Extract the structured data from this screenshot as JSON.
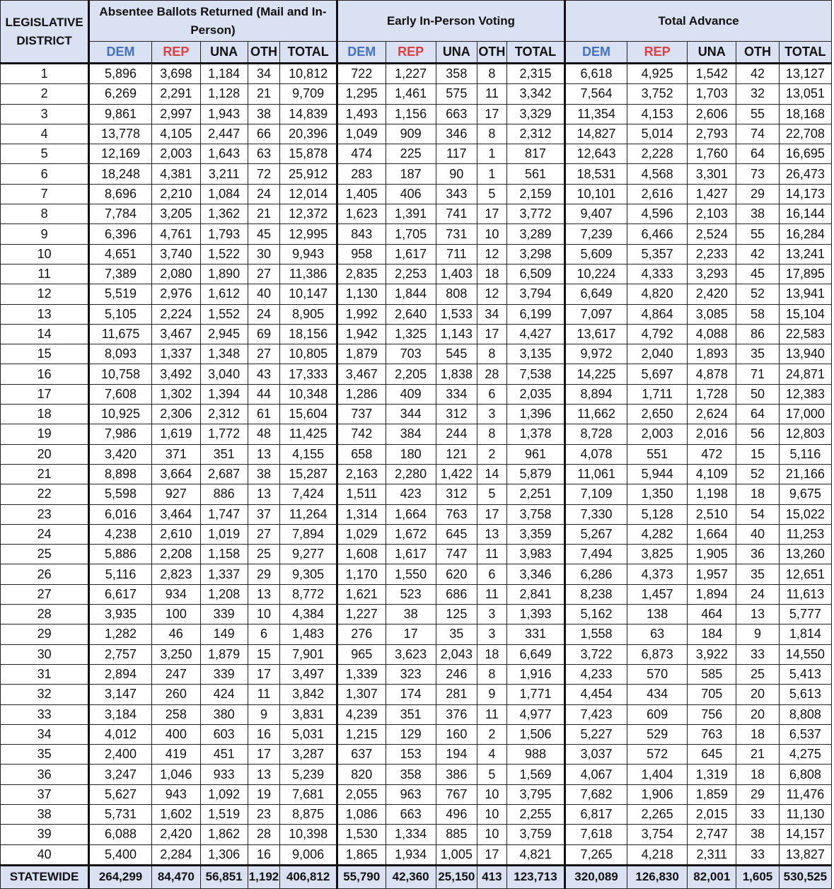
{
  "header": {
    "district_label": "LEGISLATIVE DISTRICT",
    "groups": [
      "Absentee Ballots Returned (Mail and In-Person)",
      "Early In-Person Voting",
      "Total Advance"
    ],
    "subcolumns": [
      "DEM",
      "REP",
      "UNA",
      "OTH",
      "TOTAL"
    ]
  },
  "colors": {
    "dem": "#4472c4",
    "rep": "#e04040",
    "header_bg": "#d9e1f2"
  },
  "rows": [
    [
      "1",
      "5,896",
      "3,698",
      "1,184",
      "34",
      "10,812",
      "722",
      "1,227",
      "358",
      "8",
      "2,315",
      "6,618",
      "4,925",
      "1,542",
      "42",
      "13,127"
    ],
    [
      "2",
      "6,269",
      "2,291",
      "1,128",
      "21",
      "9,709",
      "1,295",
      "1,461",
      "575",
      "11",
      "3,342",
      "7,564",
      "3,752",
      "1,703",
      "32",
      "13,051"
    ],
    [
      "3",
      "9,861",
      "2,997",
      "1,943",
      "38",
      "14,839",
      "1,493",
      "1,156",
      "663",
      "17",
      "3,329",
      "11,354",
      "4,153",
      "2,606",
      "55",
      "18,168"
    ],
    [
      "4",
      "13,778",
      "4,105",
      "2,447",
      "66",
      "20,396",
      "1,049",
      "909",
      "346",
      "8",
      "2,312",
      "14,827",
      "5,014",
      "2,793",
      "74",
      "22,708"
    ],
    [
      "5",
      "12,169",
      "2,003",
      "1,643",
      "63",
      "15,878",
      "474",
      "225",
      "117",
      "1",
      "817",
      "12,643",
      "2,228",
      "1,760",
      "64",
      "16,695"
    ],
    [
      "6",
      "18,248",
      "4,381",
      "3,211",
      "72",
      "25,912",
      "283",
      "187",
      "90",
      "1",
      "561",
      "18,531",
      "4,568",
      "3,301",
      "73",
      "26,473"
    ],
    [
      "7",
      "8,696",
      "2,210",
      "1,084",
      "24",
      "12,014",
      "1,405",
      "406",
      "343",
      "5",
      "2,159",
      "10,101",
      "2,616",
      "1,427",
      "29",
      "14,173"
    ],
    [
      "8",
      "7,784",
      "3,205",
      "1,362",
      "21",
      "12,372",
      "1,623",
      "1,391",
      "741",
      "17",
      "3,772",
      "9,407",
      "4,596",
      "2,103",
      "38",
      "16,144"
    ],
    [
      "9",
      "6,396",
      "4,761",
      "1,793",
      "45",
      "12,995",
      "843",
      "1,705",
      "731",
      "10",
      "3,289",
      "7,239",
      "6,466",
      "2,524",
      "55",
      "16,284"
    ],
    [
      "10",
      "4,651",
      "3,740",
      "1,522",
      "30",
      "9,943",
      "958",
      "1,617",
      "711",
      "12",
      "3,298",
      "5,609",
      "5,357",
      "2,233",
      "42",
      "13,241"
    ],
    [
      "11",
      "7,389",
      "2,080",
      "1,890",
      "27",
      "11,386",
      "2,835",
      "2,253",
      "1,403",
      "18",
      "6,509",
      "10,224",
      "4,333",
      "3,293",
      "45",
      "17,895"
    ],
    [
      "12",
      "5,519",
      "2,976",
      "1,612",
      "40",
      "10,147",
      "1,130",
      "1,844",
      "808",
      "12",
      "3,794",
      "6,649",
      "4,820",
      "2,420",
      "52",
      "13,941"
    ],
    [
      "13",
      "5,105",
      "2,224",
      "1,552",
      "24",
      "8,905",
      "1,992",
      "2,640",
      "1,533",
      "34",
      "6,199",
      "7,097",
      "4,864",
      "3,085",
      "58",
      "15,104"
    ],
    [
      "14",
      "11,675",
      "3,467",
      "2,945",
      "69",
      "18,156",
      "1,942",
      "1,325",
      "1,143",
      "17",
      "4,427",
      "13,617",
      "4,792",
      "4,088",
      "86",
      "22,583"
    ],
    [
      "15",
      "8,093",
      "1,337",
      "1,348",
      "27",
      "10,805",
      "1,879",
      "703",
      "545",
      "8",
      "3,135",
      "9,972",
      "2,040",
      "1,893",
      "35",
      "13,940"
    ],
    [
      "16",
      "10,758",
      "3,492",
      "3,040",
      "43",
      "17,333",
      "3,467",
      "2,205",
      "1,838",
      "28",
      "7,538",
      "14,225",
      "5,697",
      "4,878",
      "71",
      "24,871"
    ],
    [
      "17",
      "7,608",
      "1,302",
      "1,394",
      "44",
      "10,348",
      "1,286",
      "409",
      "334",
      "6",
      "2,035",
      "8,894",
      "1,711",
      "1,728",
      "50",
      "12,383"
    ],
    [
      "18",
      "10,925",
      "2,306",
      "2,312",
      "61",
      "15,604",
      "737",
      "344",
      "312",
      "3",
      "1,396",
      "11,662",
      "2,650",
      "2,624",
      "64",
      "17,000"
    ],
    [
      "19",
      "7,986",
      "1,619",
      "1,772",
      "48",
      "11,425",
      "742",
      "384",
      "244",
      "8",
      "1,378",
      "8,728",
      "2,003",
      "2,016",
      "56",
      "12,803"
    ],
    [
      "20",
      "3,420",
      "371",
      "351",
      "13",
      "4,155",
      "658",
      "180",
      "121",
      "2",
      "961",
      "4,078",
      "551",
      "472",
      "15",
      "5,116"
    ],
    [
      "21",
      "8,898",
      "3,664",
      "2,687",
      "38",
      "15,287",
      "2,163",
      "2,280",
      "1,422",
      "14",
      "5,879",
      "11,061",
      "5,944",
      "4,109",
      "52",
      "21,166"
    ],
    [
      "22",
      "5,598",
      "927",
      "886",
      "13",
      "7,424",
      "1,511",
      "423",
      "312",
      "5",
      "2,251",
      "7,109",
      "1,350",
      "1,198",
      "18",
      "9,675"
    ],
    [
      "23",
      "6,016",
      "3,464",
      "1,747",
      "37",
      "11,264",
      "1,314",
      "1,664",
      "763",
      "17",
      "3,758",
      "7,330",
      "5,128",
      "2,510",
      "54",
      "15,022"
    ],
    [
      "24",
      "4,238",
      "2,610",
      "1,019",
      "27",
      "7,894",
      "1,029",
      "1,672",
      "645",
      "13",
      "3,359",
      "5,267",
      "4,282",
      "1,664",
      "40",
      "11,253"
    ],
    [
      "25",
      "5,886",
      "2,208",
      "1,158",
      "25",
      "9,277",
      "1,608",
      "1,617",
      "747",
      "11",
      "3,983",
      "7,494",
      "3,825",
      "1,905",
      "36",
      "13,260"
    ],
    [
      "26",
      "5,116",
      "2,823",
      "1,337",
      "29",
      "9,305",
      "1,170",
      "1,550",
      "620",
      "6",
      "3,346",
      "6,286",
      "4,373",
      "1,957",
      "35",
      "12,651"
    ],
    [
      "27",
      "6,617",
      "934",
      "1,208",
      "13",
      "8,772",
      "1,621",
      "523",
      "686",
      "11",
      "2,841",
      "8,238",
      "1,457",
      "1,894",
      "24",
      "11,613"
    ],
    [
      "28",
      "3,935",
      "100",
      "339",
      "10",
      "4,384",
      "1,227",
      "38",
      "125",
      "3",
      "1,393",
      "5,162",
      "138",
      "464",
      "13",
      "5,777"
    ],
    [
      "29",
      "1,282",
      "46",
      "149",
      "6",
      "1,483",
      "276",
      "17",
      "35",
      "3",
      "331",
      "1,558",
      "63",
      "184",
      "9",
      "1,814"
    ],
    [
      "30",
      "2,757",
      "3,250",
      "1,879",
      "15",
      "7,901",
      "965",
      "3,623",
      "2,043",
      "18",
      "6,649",
      "3,722",
      "6,873",
      "3,922",
      "33",
      "14,550"
    ],
    [
      "31",
      "2,894",
      "247",
      "339",
      "17",
      "3,497",
      "1,339",
      "323",
      "246",
      "8",
      "1,916",
      "4,233",
      "570",
      "585",
      "25",
      "5,413"
    ],
    [
      "32",
      "3,147",
      "260",
      "424",
      "11",
      "3,842",
      "1,307",
      "174",
      "281",
      "9",
      "1,771",
      "4,454",
      "434",
      "705",
      "20",
      "5,613"
    ],
    [
      "33",
      "3,184",
      "258",
      "380",
      "9",
      "3,831",
      "4,239",
      "351",
      "376",
      "11",
      "4,977",
      "7,423",
      "609",
      "756",
      "20",
      "8,808"
    ],
    [
      "34",
      "4,012",
      "400",
      "603",
      "16",
      "5,031",
      "1,215",
      "129",
      "160",
      "2",
      "1,506",
      "5,227",
      "529",
      "763",
      "18",
      "6,537"
    ],
    [
      "35",
      "2,400",
      "419",
      "451",
      "17",
      "3,287",
      "637",
      "153",
      "194",
      "4",
      "988",
      "3,037",
      "572",
      "645",
      "21",
      "4,275"
    ],
    [
      "36",
      "3,247",
      "1,046",
      "933",
      "13",
      "5,239",
      "820",
      "358",
      "386",
      "5",
      "1,569",
      "4,067",
      "1,404",
      "1,319",
      "18",
      "6,808"
    ],
    [
      "37",
      "5,627",
      "943",
      "1,092",
      "19",
      "7,681",
      "2,055",
      "963",
      "767",
      "10",
      "3,795",
      "7,682",
      "1,906",
      "1,859",
      "29",
      "11,476"
    ],
    [
      "38",
      "5,731",
      "1,602",
      "1,519",
      "23",
      "8,875",
      "1,086",
      "663",
      "496",
      "10",
      "2,255",
      "6,817",
      "2,265",
      "2,015",
      "33",
      "11,130"
    ],
    [
      "39",
      "6,088",
      "2,420",
      "1,862",
      "28",
      "10,398",
      "1,530",
      "1,334",
      "885",
      "10",
      "3,759",
      "7,618",
      "3,754",
      "2,747",
      "38",
      "14,157"
    ],
    [
      "40",
      "5,400",
      "2,284",
      "1,306",
      "16",
      "9,006",
      "1,865",
      "1,934",
      "1,005",
      "17",
      "4,821",
      "7,265",
      "4,218",
      "2,311",
      "33",
      "13,827"
    ]
  ],
  "statewide": [
    "STATEWIDE",
    "264,299",
    "84,470",
    "56,851",
    "1,192",
    "406,812",
    "55,790",
    "42,360",
    "25,150",
    "413",
    "123,713",
    "320,089",
    "126,830",
    "82,001",
    "1,605",
    "530,525"
  ]
}
